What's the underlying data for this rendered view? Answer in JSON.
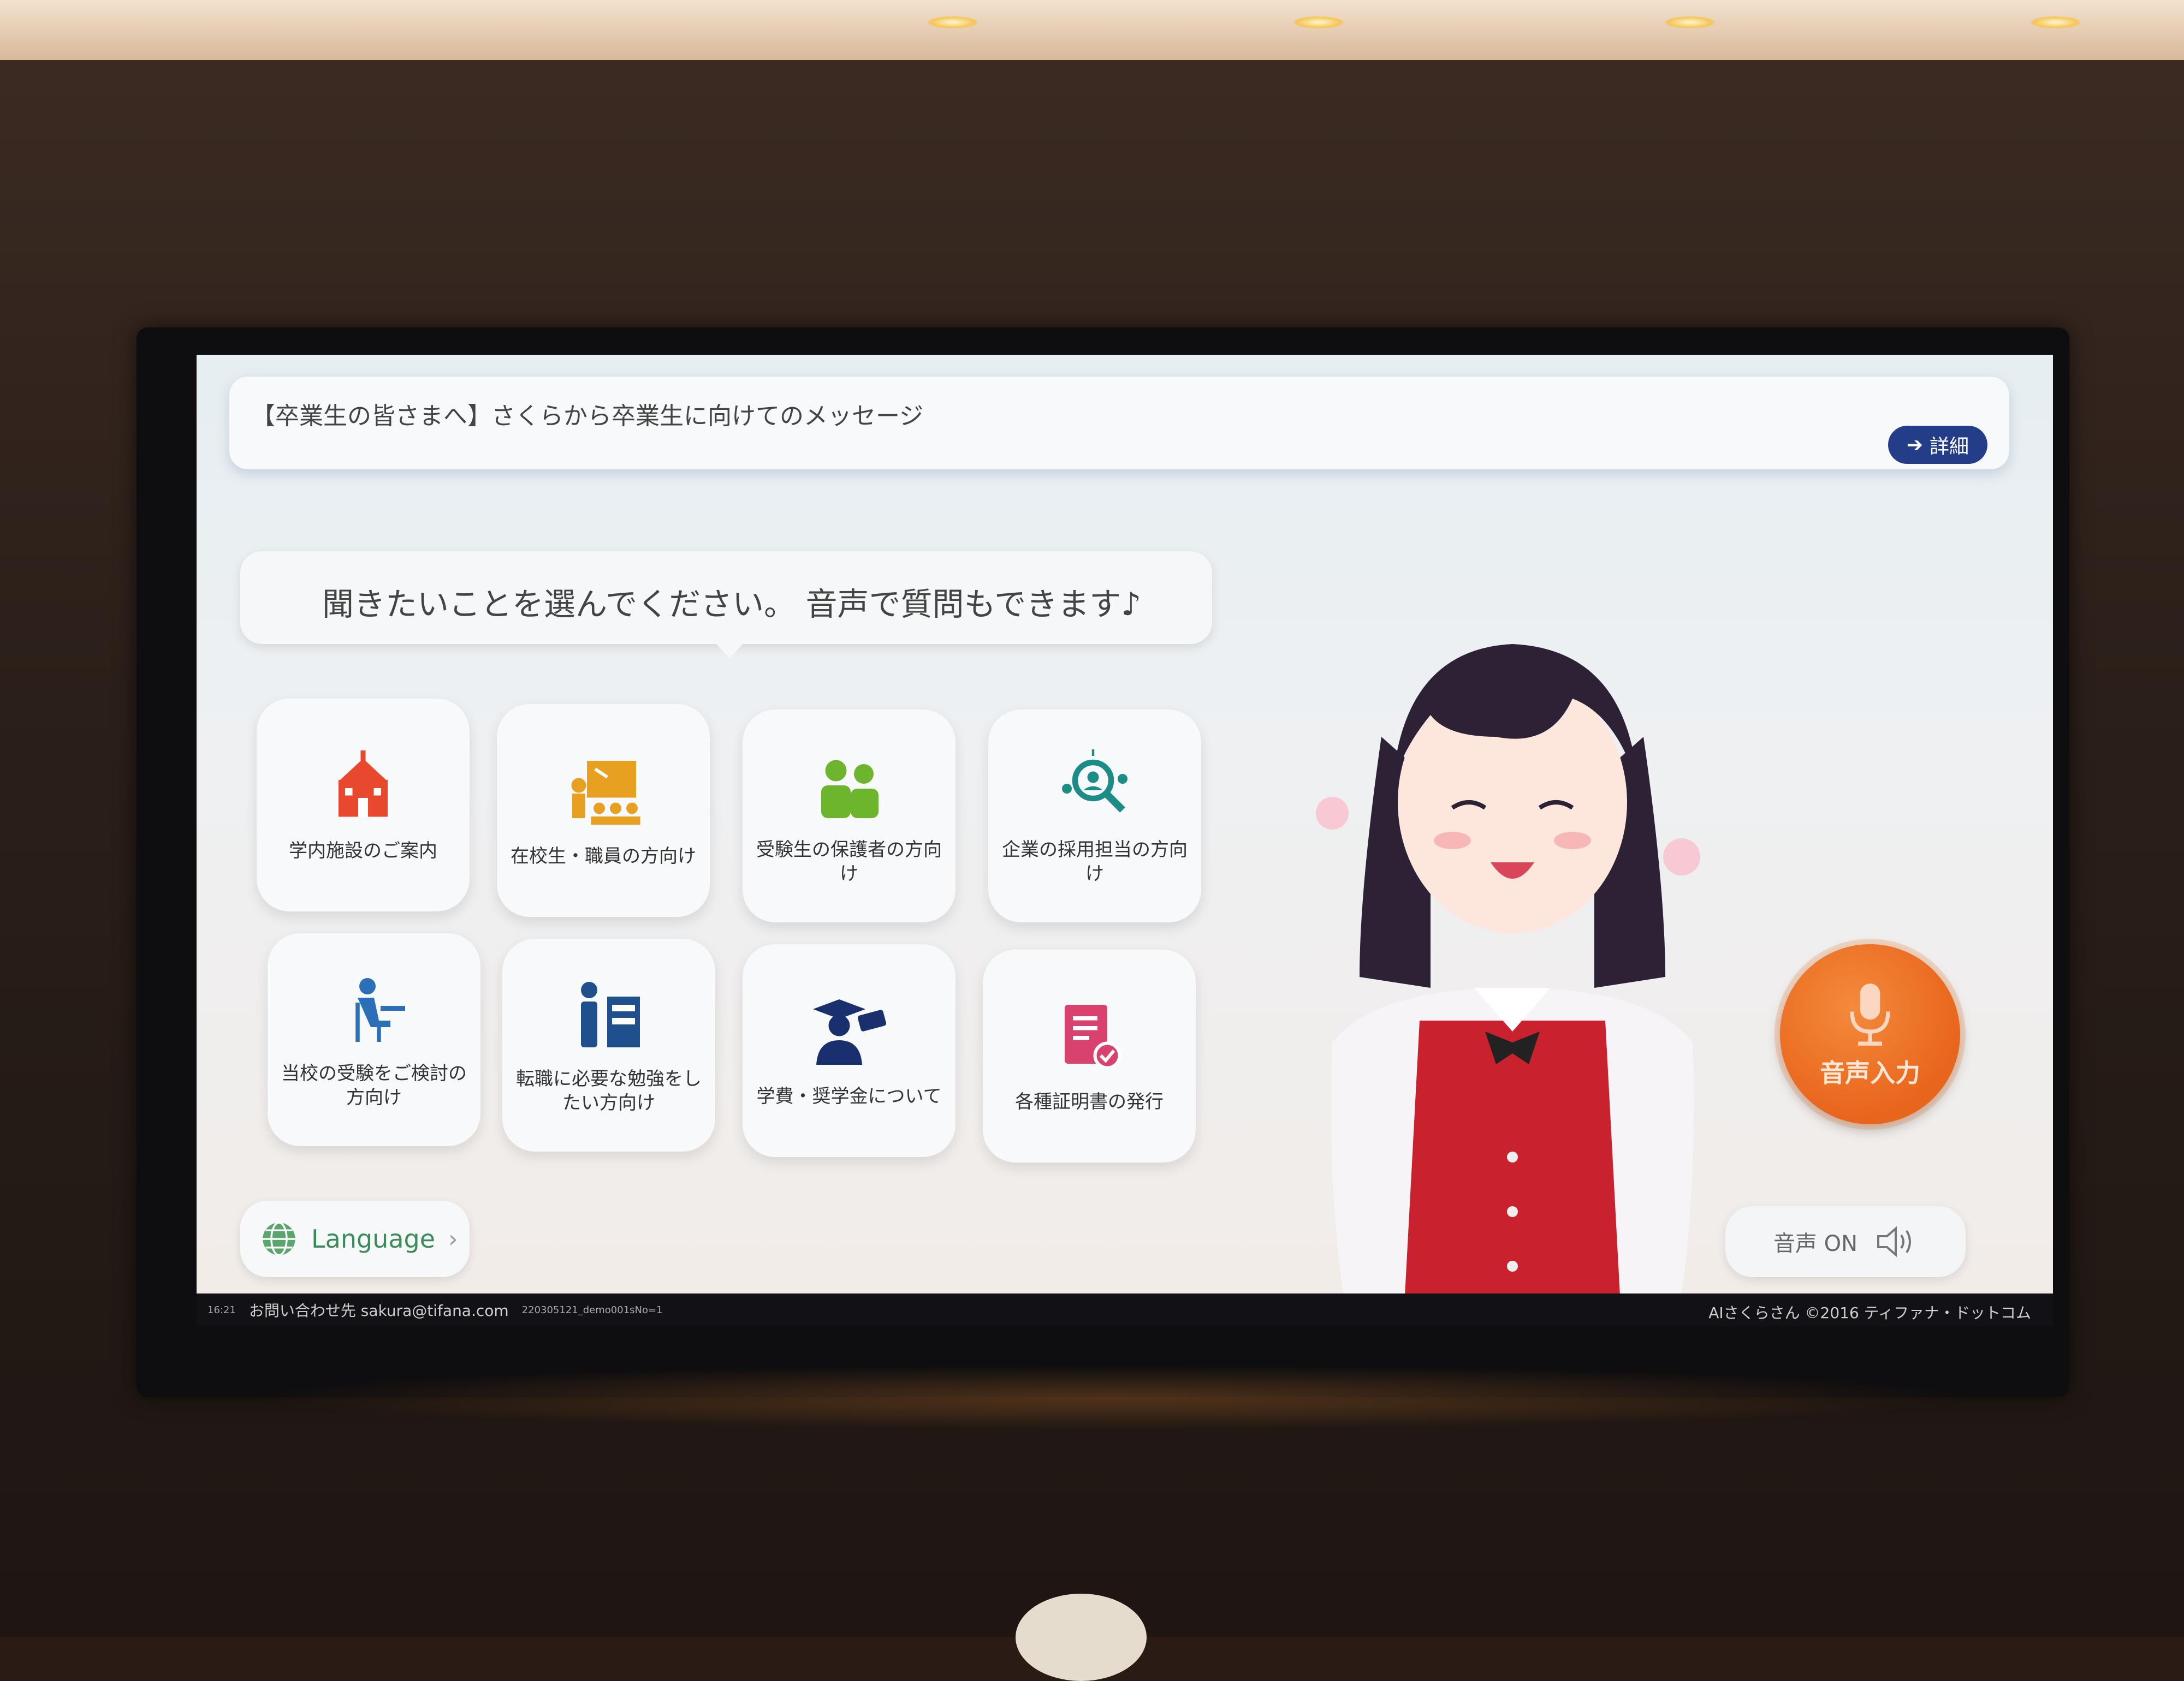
{
  "banner": {
    "text": "【卒業生の皆さまへ】さくらから卒業生に向けてのメッセージ",
    "detail_label": "詳細"
  },
  "prompt": "聞きたいことを選んでください。 音声で質問もできます♪",
  "tiles": [
    {
      "label": "学内施設のご案内",
      "icon": "school-building-icon",
      "color": "#e8492d"
    },
    {
      "label": "在校生・職員の方向け",
      "icon": "teacher-board-icon",
      "color": "#e8a020"
    },
    {
      "label": "受験生の保護者の方向け",
      "icon": "parents-icon",
      "color": "#6cb52d"
    },
    {
      "label": "企業の採用担当の方向け",
      "icon": "recruit-search-icon",
      "color": "#1c8c86"
    },
    {
      "label": "当校の受験をご検討の方向け",
      "icon": "student-desk-icon",
      "color": "#2a6fb8"
    },
    {
      "label": "転職に必要な勉強をしたい方向け",
      "icon": "career-change-icon",
      "color": "#1f4f8c"
    },
    {
      "label": "学費・奨学金について",
      "icon": "graduate-money-icon",
      "color": "#1a2f6e"
    },
    {
      "label": "各種証明書の発行",
      "icon": "certificate-icon",
      "color": "#d9426f"
    }
  ],
  "language": {
    "label": "Language",
    "icon": "globe-icon"
  },
  "mic": {
    "label": "音声入力",
    "icon": "microphone-icon"
  },
  "voice": {
    "label": "音声 ON",
    "icon": "speaker-icon"
  },
  "footer": {
    "time": "16:21",
    "contact": "お問い合わせ先 sakura@tifana.com",
    "build": "220305121_demo001sNo=1",
    "copyright": "AIさくらさん ©2016 ティファナ・ドットコム"
  }
}
